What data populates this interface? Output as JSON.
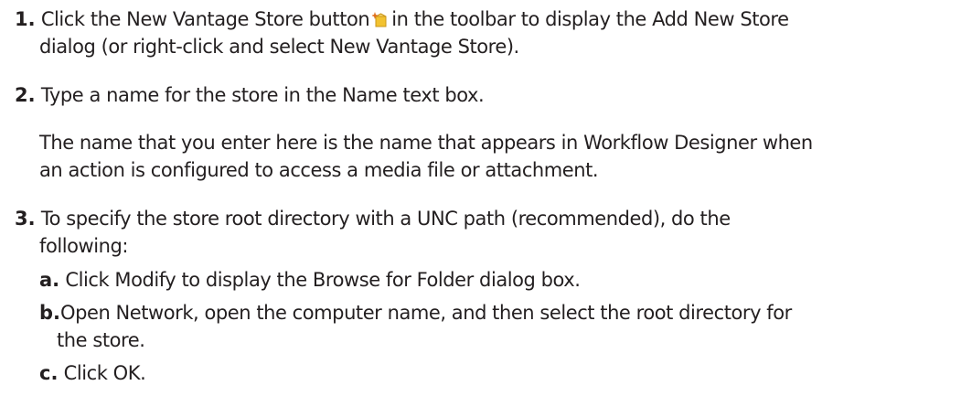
{
  "steps": [
    {
      "number": "1.",
      "text_before_icon": "Click the New Vantage Store button",
      "icon": "new-store-icon",
      "text_after_icon": "in the toolbar to display the Add New Store",
      "text_cont": "dialog (or right-click and select New Vantage Store)."
    },
    {
      "number": "2.",
      "text": "Type a name for the store in the Name text box.",
      "note_line1": "The name that you enter here is the name that appears in Workflow Designer when",
      "note_line2": "an action is configured to access a media file or attachment."
    },
    {
      "number": "3.",
      "text": "To specify the store root directory with a UNC path (recommended), do the",
      "text_cont": "following:",
      "substeps": [
        {
          "letter": "a.",
          "text": "Click Modify to display the Browse for Folder dialog box."
        },
        {
          "letter": "b.",
          "text": "Open Network, open the computer name, and then select the root directory for",
          "text_cont": "the store."
        },
        {
          "letter": "c.",
          "text": "Click OK."
        }
      ]
    }
  ],
  "icon_colors": {
    "body": "#f2c230",
    "spark": "#e0701f"
  }
}
